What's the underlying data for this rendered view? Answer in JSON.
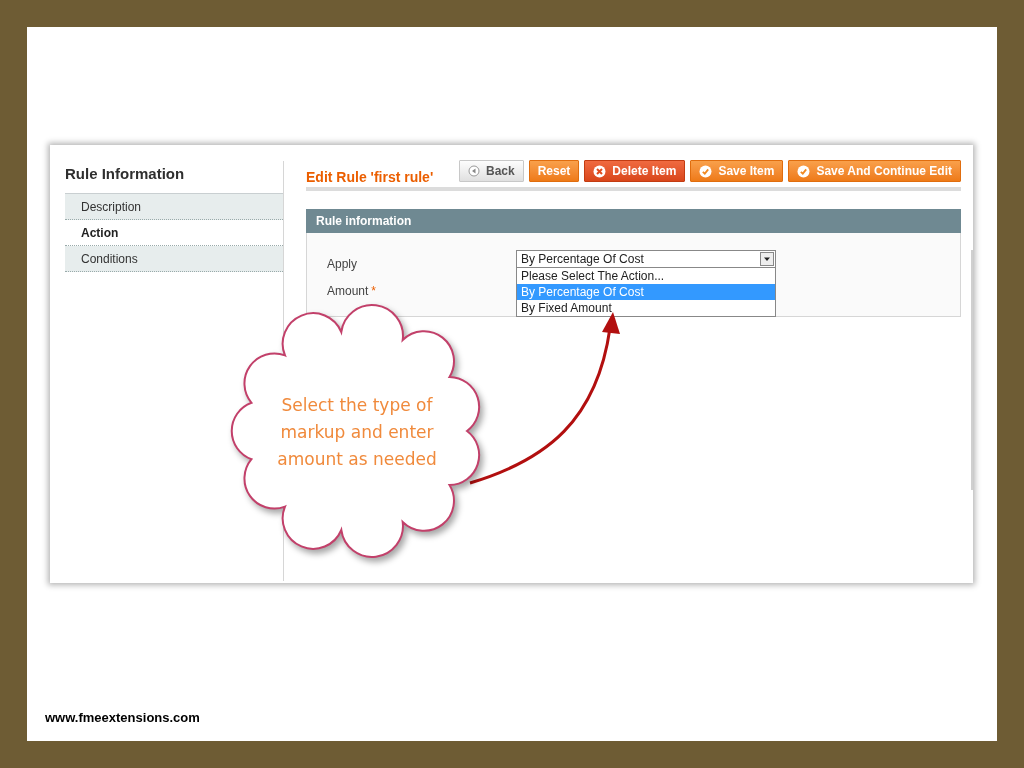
{
  "sidebar": {
    "title": "Rule Information",
    "items": [
      {
        "label": "Description",
        "selected": false
      },
      {
        "label": "Action",
        "selected": true
      },
      {
        "label": "Conditions",
        "selected": false
      }
    ]
  },
  "page_title": "Edit Rule 'first rule'",
  "buttons": [
    {
      "label": "Back",
      "kind": "back"
    },
    {
      "label": "Reset",
      "kind": "plain"
    },
    {
      "label": "Delete Item",
      "kind": "delete"
    },
    {
      "label": "Save Item",
      "kind": "save"
    },
    {
      "label": "Save And Continue Edit",
      "kind": "save"
    }
  ],
  "section": {
    "title": "Rule information",
    "fields": [
      {
        "label": "Apply",
        "value": "By Percentage Of Cost",
        "options": [
          {
            "label": "Please Select The Action...",
            "selected": false
          },
          {
            "label": "By Percentage Of Cost",
            "selected": true
          },
          {
            "label": "By Fixed Amount",
            "selected": false
          }
        ]
      },
      {
        "label": "Amount",
        "required_mark": "*"
      }
    ]
  },
  "callout": {
    "text": "Select the type of markup and enter amount as needed"
  },
  "footer": "www.fmeextensions.com"
}
